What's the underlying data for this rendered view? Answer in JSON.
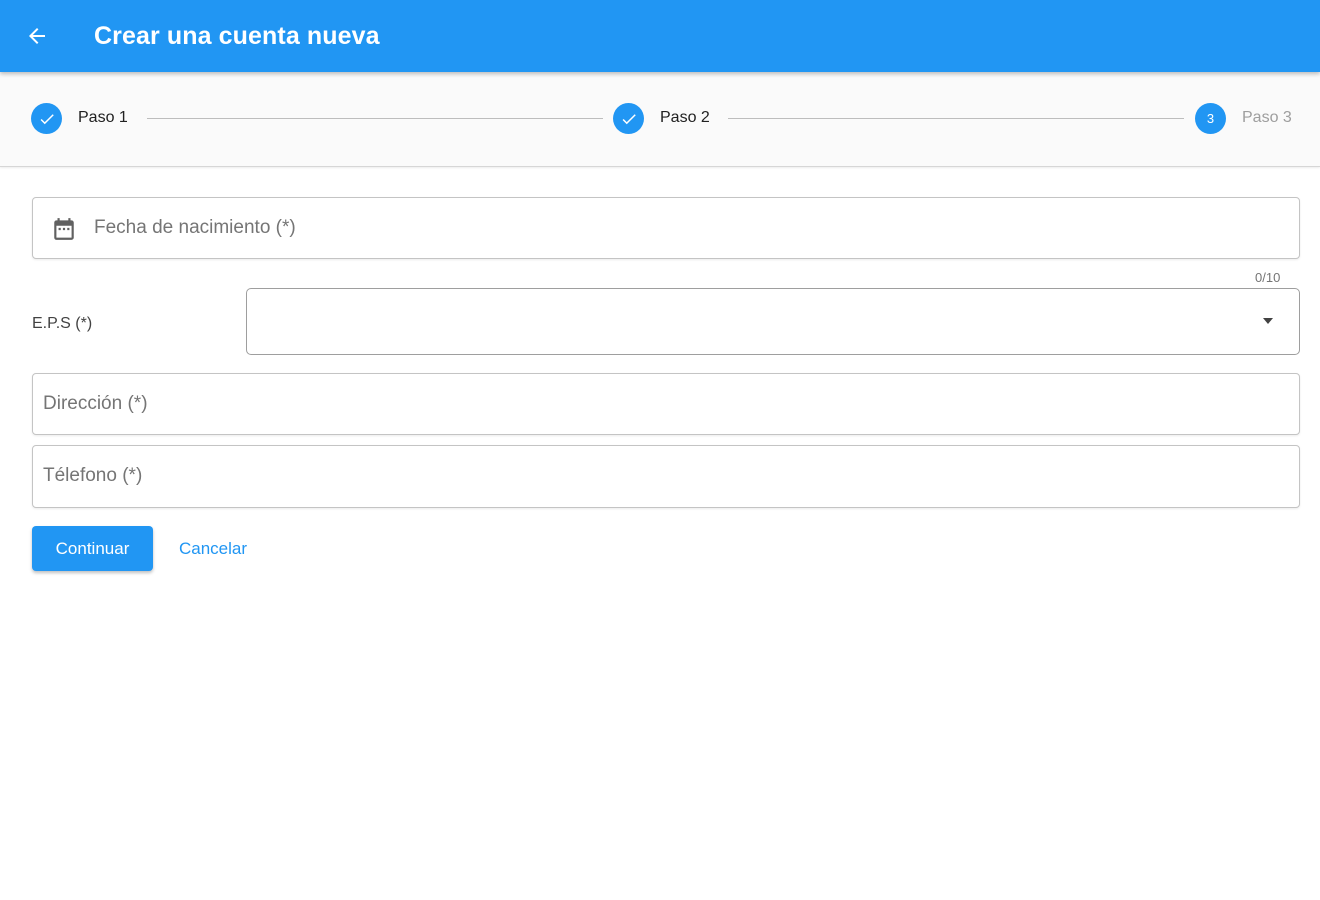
{
  "appbar": {
    "title": "Crear una cuenta nueva",
    "back_icon": "arrow-left-icon",
    "color": "#2196f3"
  },
  "stepper": {
    "steps": [
      {
        "label": "Paso 1",
        "state": "completed",
        "icon": "check-icon"
      },
      {
        "label": "Paso 2",
        "state": "completed",
        "icon": "check-icon"
      },
      {
        "label": "Paso 3",
        "state": "active",
        "number": "3"
      }
    ]
  },
  "form": {
    "birth_date": {
      "placeholder": "Fecha de nacimiento (*)",
      "icon": "calendar-icon",
      "value": ""
    },
    "eps": {
      "label": "E.P.S (*)",
      "counter": "0/10",
      "value": ""
    },
    "address": {
      "placeholder": "Dirección (*)",
      "value": ""
    },
    "phone": {
      "placeholder": "Télefono (*)",
      "value": ""
    }
  },
  "actions": {
    "continue_label": "Continuar",
    "cancel_label": "Cancelar"
  }
}
